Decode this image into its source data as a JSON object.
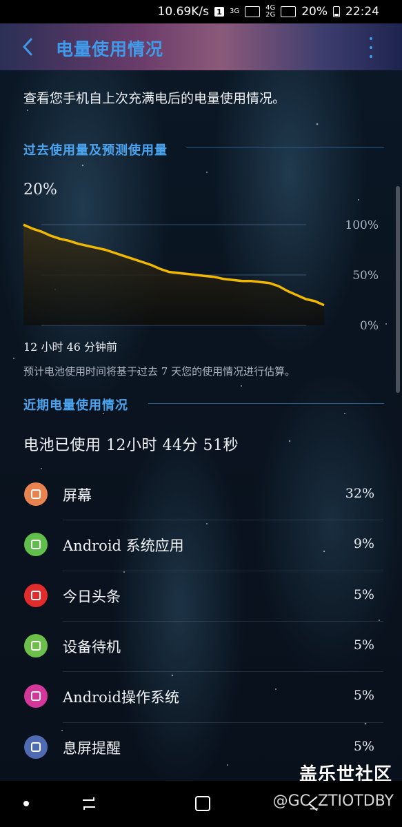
{
  "status_bar": {
    "speed": "10.69K/s",
    "notification_badge": "1",
    "net1": "3G",
    "net2_top": "4G",
    "net2_bottom": "2G",
    "battery_percent": "20%",
    "time": "22:24",
    "icons": [
      "speed",
      "notification-badge-icon",
      "signal-icon",
      "signal-icon",
      "battery-icon"
    ]
  },
  "header": {
    "title": "电量使用情况",
    "back_icon": "chevron-left-icon",
    "more_icon": "more-vert-icon"
  },
  "intro": "查看您手机自上次充满电后的电量使用情况。",
  "past_section": {
    "title": "过去使用量及预测使用量",
    "current_percent": "20%",
    "time_since": "12 小时 46 分钟前",
    "note": "预计电池使用时间将基于过去 7 天您的使用情况进行估算。"
  },
  "chart_data": {
    "type": "area",
    "title": "",
    "xlabel": "",
    "ylabel": "",
    "ylim": [
      0,
      100
    ],
    "y_ticks": [
      "100%",
      "50%",
      "0%"
    ],
    "x_label_start": "12 小时 46 分钟前",
    "grid": true,
    "line_color": "#f0b800",
    "series": [
      {
        "points": [
          [
            0,
            100
          ],
          [
            3,
            96
          ],
          [
            6,
            93
          ],
          [
            9,
            89
          ],
          [
            12,
            86
          ],
          [
            15,
            84
          ],
          [
            18,
            81
          ],
          [
            21,
            79
          ],
          [
            24,
            77
          ],
          [
            27,
            75
          ],
          [
            30,
            72
          ],
          [
            33,
            69
          ],
          [
            36,
            66
          ],
          [
            39,
            63
          ],
          [
            42,
            60
          ],
          [
            45,
            56
          ],
          [
            48,
            53
          ],
          [
            51,
            52
          ],
          [
            54,
            51
          ],
          [
            57,
            50
          ],
          [
            60,
            49
          ],
          [
            63,
            48
          ],
          [
            66,
            46
          ],
          [
            69,
            45
          ],
          [
            72,
            44
          ],
          [
            75,
            44
          ],
          [
            78,
            43
          ],
          [
            81,
            42
          ],
          [
            84,
            39
          ],
          [
            87,
            34
          ],
          [
            90,
            30
          ],
          [
            93,
            26
          ],
          [
            96,
            24
          ],
          [
            99,
            20
          ]
        ]
      }
    ]
  },
  "recent_section": {
    "title": "近期电量使用情况",
    "battery_used": "电池已使用 12小时 44分 51秒"
  },
  "apps": [
    {
      "name": "屏幕",
      "value": "32%",
      "icon": "screen-icon",
      "icon_color": "#e8824f"
    },
    {
      "name": "Android 系统应用",
      "value": "9%",
      "icon": "android-system-icon",
      "icon_color": "#5fbf4a"
    },
    {
      "name": "今日头条",
      "value": "5%",
      "icon": "toutiao-icon",
      "icon_color": "#e22c2c"
    },
    {
      "name": "设备待机",
      "value": "5%",
      "icon": "power-icon",
      "icon_color": "#6cc04a"
    },
    {
      "name": "Android操作系统",
      "value": "5%",
      "icon": "android-os-icon",
      "icon_color": "#d4379a"
    },
    {
      "name": "息屏提醒",
      "value": "5%",
      "icon": "clock-icon",
      "icon_color": "#4e6bb4"
    }
  ],
  "watermark": "盖乐世社区",
  "handle": "@GC_ZTIOTDBY",
  "nav_icons": [
    "dot-icon",
    "recent-apps-icon",
    "home-icon",
    "back-icon"
  ]
}
